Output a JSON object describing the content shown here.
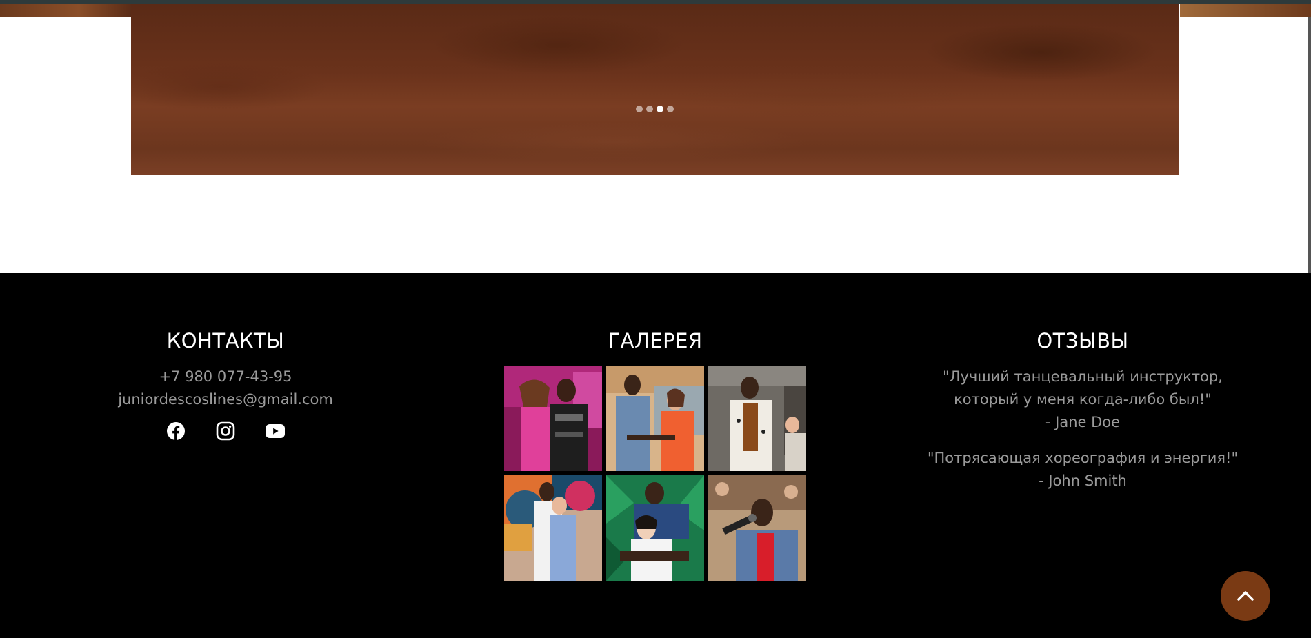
{
  "slider": {
    "dots": [
      {
        "label": "",
        "active": false
      },
      {
        "label": "",
        "active": false
      },
      {
        "label": "",
        "active": true
      },
      {
        "label": "",
        "active": false
      }
    ]
  },
  "footer": {
    "contacts": {
      "title": "КОНТАКТЫ",
      "phone": "+7 980 077-43-95",
      "email": "juniordescoslines@gmail.com",
      "social": [
        "facebook-icon",
        "instagram-icon",
        "youtube-icon"
      ]
    },
    "gallery": {
      "title": "ГАЛЕРЕЯ",
      "tiles": 6
    },
    "reviews": {
      "title": "ОТЗЫВЫ",
      "items": [
        {
          "quote_line1": "\"Лучший танцевальный инструктор,",
          "quote_line2": "который у меня когда-либо был!\"",
          "author": "- Jane Doe"
        },
        {
          "quote_line1": "\"Потрясающая хореография и энергия!\"",
          "author": "- John Smith"
        }
      ]
    }
  },
  "colors": {
    "footer_bg": "#000000",
    "accent_brown": "#7a3a14",
    "muted_text": "#9a9a9a"
  }
}
